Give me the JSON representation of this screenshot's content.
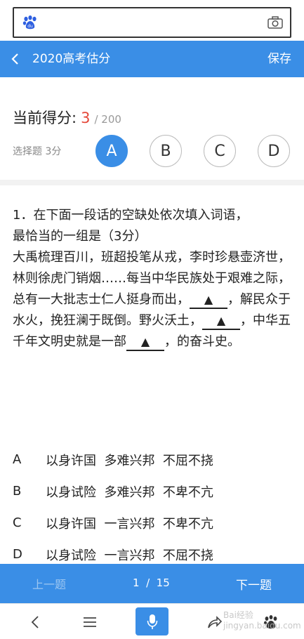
{
  "search": {
    "placeholder": ""
  },
  "header": {
    "title": "2020高考估分",
    "save_label": "保存"
  },
  "score": {
    "label": "当前得分:",
    "value": "3",
    "total": "/ 200"
  },
  "question_type": "选择题 3分",
  "answer_options": [
    "A",
    "B",
    "C",
    "D"
  ],
  "selected_option": "A",
  "question": {
    "stem_line1": "1．在下面一段话的空缺处依次填入词语，",
    "stem_line2": "最恰当的一组是（3分）",
    "passage_part1": "大禹梳理百川，班超投笔从戎，李时珍悬壶济世，林则徐虎门销烟……每当中华民族处于艰难之际，总有一大批志士仁人挺身而出，",
    "blank1": "▲",
    "passage_part2": "，解民众于水火，挽狂澜于既倒。野火沃土，",
    "blank2": "▲",
    "passage_part3": "，中华五千年文明史就是一部",
    "blank3": "▲",
    "passage_part4": "，的奋斗史。"
  },
  "choices": [
    {
      "letter": "A",
      "text": "以身许国  多难兴邦  不屈不挠"
    },
    {
      "letter": "B",
      "text": "以身试险  多难兴邦  不卑不亢"
    },
    {
      "letter": "C",
      "text": "以身许国  一言兴邦  不卑不亢"
    },
    {
      "letter": "D",
      "text": "以身试险  一言兴邦  不屈不挠"
    }
  ],
  "pager": {
    "prev_label": "上一题",
    "page": "1  /  15",
    "next_label": "下一题"
  },
  "watermark": "Bai经验 jingyan.baidu.com",
  "colors": {
    "accent": "#3a8ee6",
    "score": "#e5483a"
  },
  "icons": [
    "baidu-paw-icon",
    "camera-icon",
    "back-icon",
    "menu-icon",
    "mic-icon",
    "share-icon",
    "paw-icon"
  ]
}
